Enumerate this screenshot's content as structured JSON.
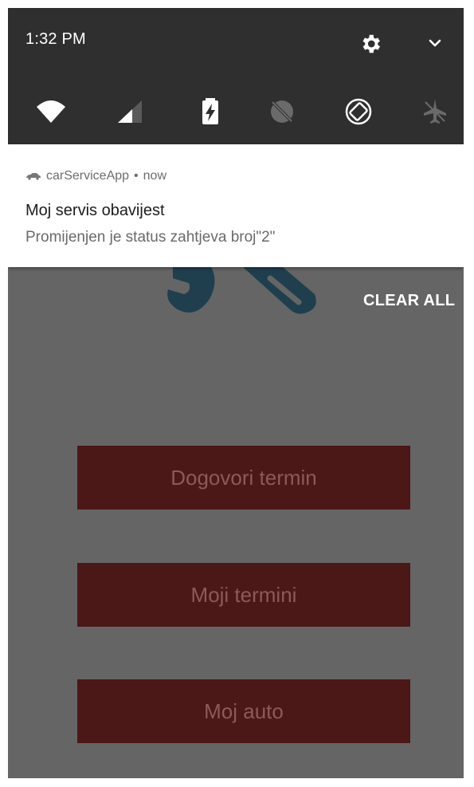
{
  "status_bar": {
    "time": "1:32 PM"
  },
  "quick_settings": {
    "icons": [
      "settings-gear-icon",
      "chevron-down-icon",
      "wifi-icon",
      "cellular-signal-icon",
      "battery-charging-icon",
      "location-off-icon",
      "auto-rotate-icon",
      "airplane-mode-icon"
    ]
  },
  "notification": {
    "app_name": "carServiceApp",
    "separator": "•",
    "time": "now",
    "title": "Moj servis obavijest",
    "text": "Promijenjen je status zahtjeva broj\"2\""
  },
  "shade_actions": {
    "clear_all": "CLEAR ALL"
  },
  "app": {
    "buttons": {
      "book_appointment": "Dogovori termin",
      "my_appointments": "Moji termini",
      "my_car": "Moj auto"
    }
  },
  "colors": {
    "shade_bg": "#2f2f2f",
    "scrim_bg": "#656565",
    "button_bg": "#4b1717",
    "button_text": "#8c5a5a",
    "logo_color": "#1f3f4f"
  }
}
